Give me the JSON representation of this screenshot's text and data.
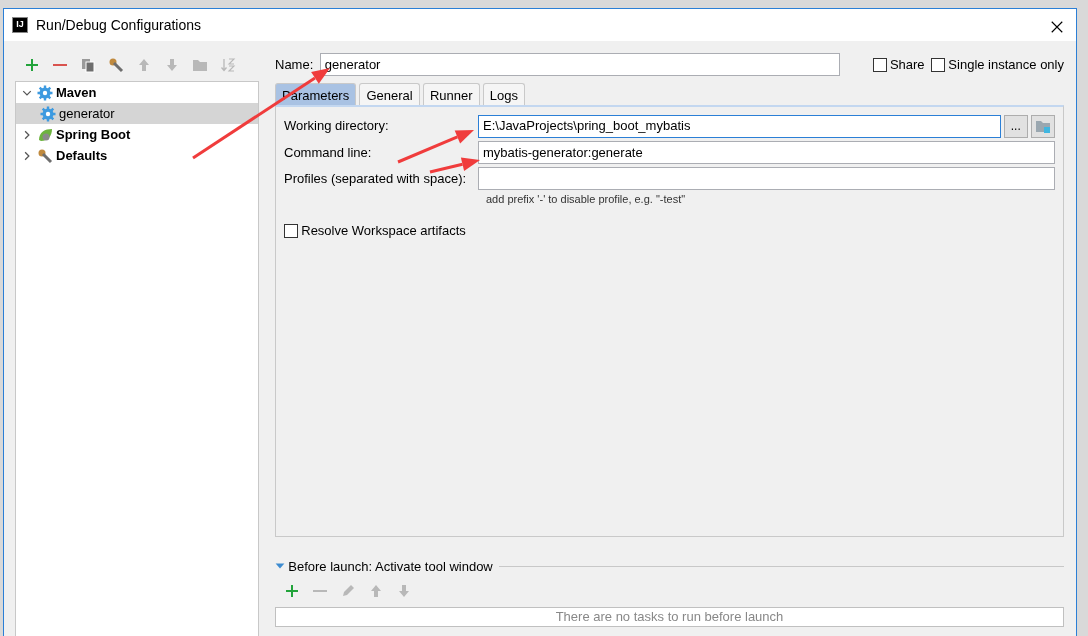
{
  "window": {
    "title": "Run/Debug Configurations",
    "app_badge": "IJ"
  },
  "toolbar": [
    {
      "kind": "add",
      "disabled": false
    },
    {
      "kind": "remove",
      "disabled": false
    },
    {
      "kind": "copy",
      "disabled": false
    },
    {
      "kind": "wrench",
      "disabled": false
    },
    {
      "kind": "up",
      "disabled": true
    },
    {
      "kind": "down",
      "disabled": true
    },
    {
      "kind": "folder",
      "disabled": true
    },
    {
      "kind": "sort",
      "disabled": true
    }
  ],
  "tree": [
    {
      "label": "Maven",
      "kind": "maven",
      "expanded": true,
      "selected": false,
      "children": [
        {
          "label": "generator",
          "kind": "maven",
          "selected": true
        }
      ]
    },
    {
      "label": "Spring Boot",
      "kind": "spring",
      "expanded": false,
      "selected": false
    },
    {
      "label": "Defaults",
      "kind": "defaults",
      "expanded": false,
      "selected": false
    }
  ],
  "name_field": {
    "label": "Name:",
    "value": "generator"
  },
  "options": [
    {
      "label": "Share",
      "checked": false
    },
    {
      "label": "Single instance only",
      "checked": false
    }
  ],
  "tabs": [
    {
      "label": "Parameters",
      "selected": true
    },
    {
      "label": "General",
      "selected": false
    },
    {
      "label": "Runner",
      "selected": false
    },
    {
      "label": "Logs",
      "selected": false
    }
  ],
  "fields": [
    {
      "label": "Working directory:",
      "value": "E:\\JavaProjects\\pring_boot_mybatis",
      "focused": true,
      "browse": "..."
    },
    {
      "label": "Command line:",
      "value": "mybatis-generator:generate",
      "focused": false
    },
    {
      "label": "Profiles (separated with space):",
      "focused": false,
      "hint": "add prefix '-' to disable profile, e.g. \"-test\""
    }
  ],
  "resolve_checkbox": {
    "label": "Resolve Workspace artifacts",
    "checked": false
  },
  "before_launch": {
    "title": "Before launch: Activate tool window",
    "expanded": true,
    "toolbar": [
      {
        "kind": "add",
        "disabled": false
      },
      {
        "kind": "remove",
        "disabled": true
      },
      {
        "kind": "edit",
        "disabled": true
      },
      {
        "kind": "up",
        "disabled": true
      },
      {
        "kind": "down",
        "disabled": true
      }
    ],
    "empty_text": "There are no tasks to run before launch"
  }
}
